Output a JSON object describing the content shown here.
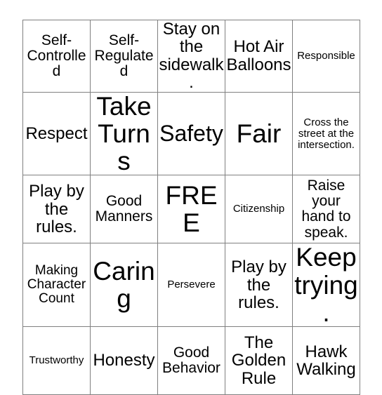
{
  "card": {
    "type": "bingo-card",
    "rows": 5,
    "columns": 5,
    "border_color": "#808080",
    "background_color": "#ffffff",
    "text_color": "#000000",
    "free_space": {
      "row": 3,
      "column": 3,
      "label": "FREE"
    },
    "cells": [
      [
        {
          "text": "Self-Controlled",
          "size": "fs-m"
        },
        {
          "text": "Self-Regulated",
          "size": "fs-m"
        },
        {
          "text": "Stay on the sidewalk.",
          "size": "fs-l"
        },
        {
          "text": "Hot Air Balloons",
          "size": "fs-l"
        },
        {
          "text": "Responsible",
          "size": "fs-xs"
        }
      ],
      [
        {
          "text": "Respect",
          "size": "fs-l"
        },
        {
          "text": "Take Turns",
          "size": "fs-xxl"
        },
        {
          "text": "Safety",
          "size": "fs-xl"
        },
        {
          "text": "Fair",
          "size": "fs-xxl"
        },
        {
          "text": "Cross the street at the intersection.",
          "size": "fs-xs"
        }
      ],
      [
        {
          "text": "Play by the rules.",
          "size": "fs-l"
        },
        {
          "text": "Good Manners",
          "size": "fs-m"
        },
        {
          "text": "FREE",
          "size": "fs-xxl"
        },
        {
          "text": "Citizenship",
          "size": "fs-xs"
        },
        {
          "text": "Raise your hand to speak.",
          "size": "fs-m"
        }
      ],
      [
        {
          "text": "Making Character Count",
          "size": "fs-s"
        },
        {
          "text": "Caring",
          "size": "fs-xxl"
        },
        {
          "text": "Persevere",
          "size": "fs-xs"
        },
        {
          "text": "Play by the rules.",
          "size": "fs-l"
        },
        {
          "text": "Keep trying.",
          "size": "fs-xxl"
        }
      ],
      [
        {
          "text": "Trustworthy",
          "size": "fs-xs"
        },
        {
          "text": "Honesty",
          "size": "fs-l"
        },
        {
          "text": "Good Behavior",
          "size": "fs-m"
        },
        {
          "text": "The Golden Rule",
          "size": "fs-l"
        },
        {
          "text": "Hawk Walking",
          "size": "fs-l"
        }
      ]
    ]
  }
}
